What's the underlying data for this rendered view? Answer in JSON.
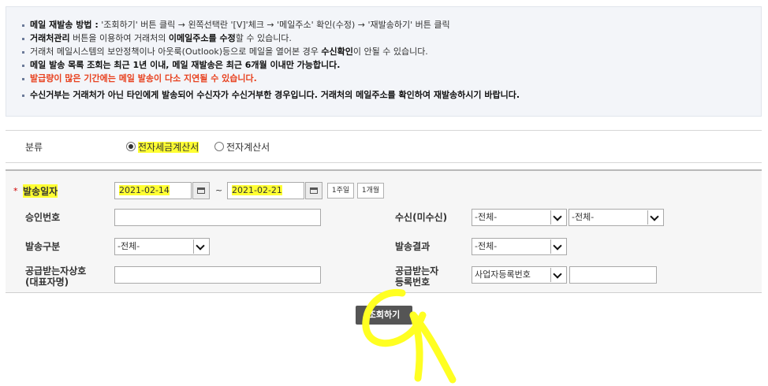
{
  "notice": {
    "line1_bold": "메일 재발송 방법 :",
    "line1_rest": " '조회하기' 버튼 클릭 → 왼쪽선택란 '[V]'체크 → '메일주소' 확인(수정) → '재발송하기' 버튼 클릭",
    "line2_bold": "거래처관리",
    "line2_mid": " 버튼을 이용하여 거래처의 ",
    "line2_bold2": "이메일주소를 수정",
    "line2_end": "할 수 있습니다.",
    "line3_start": "거래처 메일시스템의 보안정책이나 아웃룩(Outlook)등으로 메일을 열어본 경우 ",
    "line3_bold": "수신확인",
    "line3_end": "이 안될 수 있습니다.",
    "line4": "메일 발송 목록 조회는 최근 1년 이내, 메일 재발송은 최근 6개월 이내만 가능합니다.",
    "line5": "발급량이 많은 기간에는 메일 발송이 다소 지연될 수 있습니다.",
    "line6": "수신거부는 거래처가 아닌 타인에게 발송되어 수신자가 수신거부한 경우입니다. 거래처의 메일주소를 확인하여 재발송하시기 바랍니다."
  },
  "category": {
    "label": "분류",
    "option1": "전자세금계산서",
    "option2": "전자계산서"
  },
  "form": {
    "required_mark": "*",
    "send_date_label": "발송일자",
    "date_from": "2021-02-14",
    "date_to": "2021-02-21",
    "tilde": "~",
    "one_week": "1주일",
    "one_month": "1개월",
    "approval_label": "승인번호",
    "approval_value": "",
    "receive_label": "수신(미수신)",
    "receive_select1": "-전체-",
    "receive_select2": "-전체-",
    "send_type_label": "발송구분",
    "send_type_value": "-전체-",
    "send_result_label": "발송결과",
    "send_result_value": "-전체-",
    "recipient_name_label1": "공급받는자상호",
    "recipient_name_label2": "(대표자명)",
    "recipient_name_value": "",
    "recipient_reg_label1": "공급받는자",
    "recipient_reg_label2": "등록번호",
    "reg_type_value": "사업자등록번호",
    "reg_number_value": ""
  },
  "search_button": "조회하기",
  "colors": {
    "highlight": "#ffff33",
    "warning": "#e8411f",
    "required": "#d00000"
  }
}
